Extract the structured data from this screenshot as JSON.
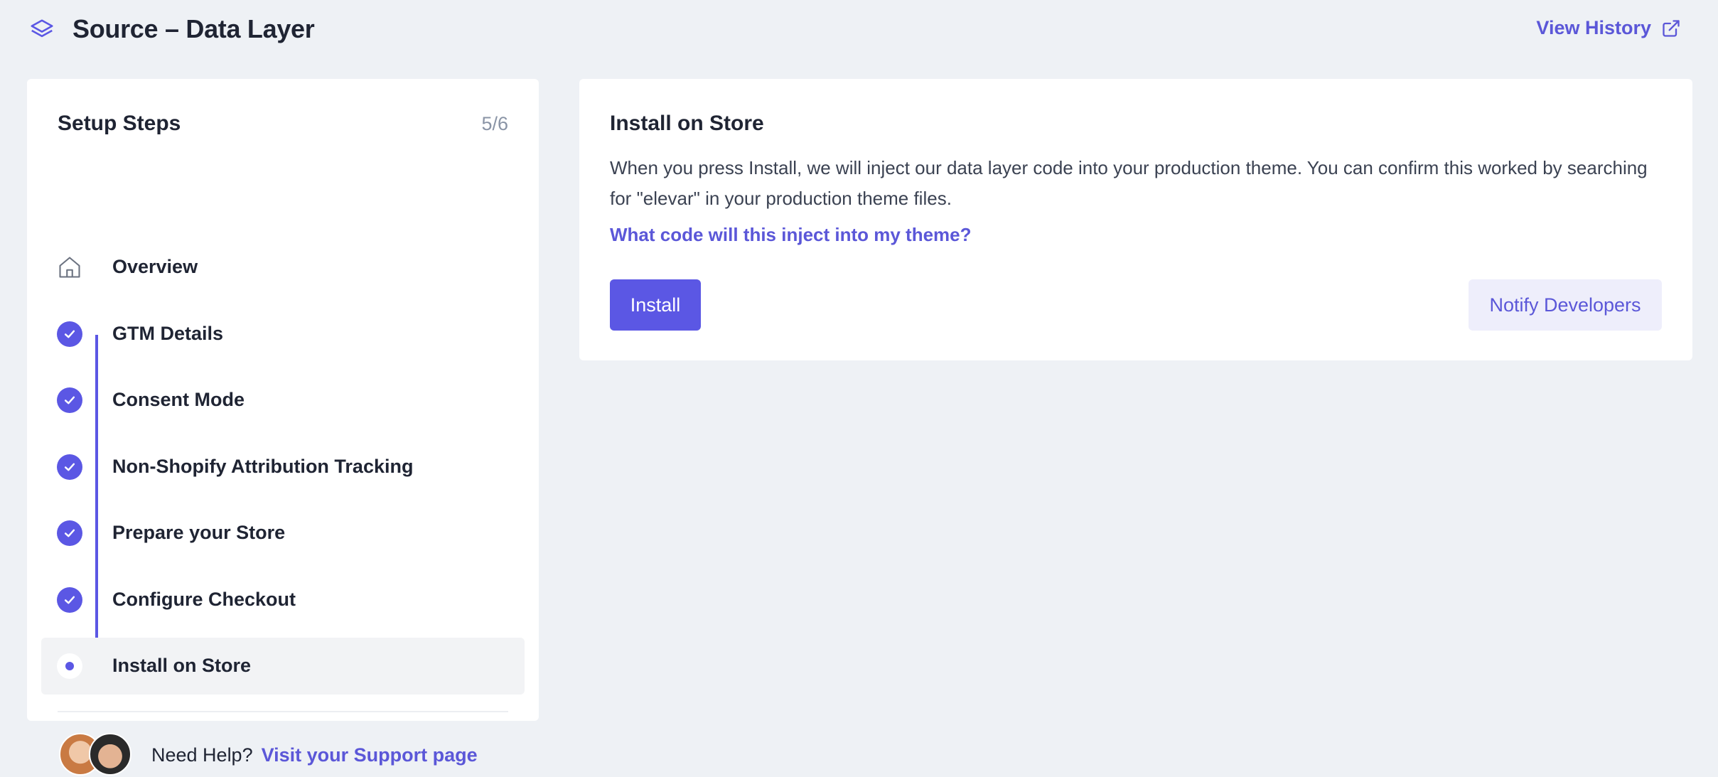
{
  "header": {
    "title": "Source – Data Layer",
    "view_history_label": "View History",
    "icons": {
      "title_icon": "layers-icon",
      "history_icon": "external-link-icon"
    }
  },
  "colors": {
    "accent": "#5b57e4",
    "background": "#eef1f5",
    "card": "#ffffff"
  },
  "steps": {
    "title": "Setup Steps",
    "count": "5/6",
    "items": [
      {
        "label": "Overview",
        "state": "home"
      },
      {
        "label": "GTM Details",
        "state": "done"
      },
      {
        "label": "Consent Mode",
        "state": "done"
      },
      {
        "label": "Non-Shopify Attribution Tracking",
        "state": "done"
      },
      {
        "label": "Prepare your Store",
        "state": "done"
      },
      {
        "label": "Configure Checkout",
        "state": "done"
      },
      {
        "label": "Install on Store",
        "state": "current"
      }
    ]
  },
  "help": {
    "text": "Need Help?",
    "link": "Visit your Support page"
  },
  "install": {
    "title": "Install on Store",
    "description": "When you press Install, we will inject our data layer code into your production theme. You can confirm this worked by searching for \"elevar\" in your production theme files.",
    "link": "What code will this inject into my theme?",
    "install_button": "Install",
    "notify_button": "Notify Developers"
  }
}
